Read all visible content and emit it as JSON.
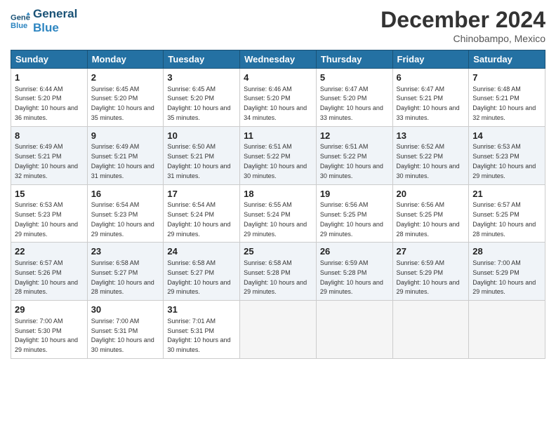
{
  "logo": {
    "line1": "General",
    "line2": "Blue"
  },
  "title": "December 2024",
  "subtitle": "Chinobampo, Mexico",
  "weekdays": [
    "Sunday",
    "Monday",
    "Tuesday",
    "Wednesday",
    "Thursday",
    "Friday",
    "Saturday"
  ],
  "weeks": [
    [
      {
        "day": "1",
        "sunrise": "6:44 AM",
        "sunset": "5:20 PM",
        "daylight": "10 hours and 36 minutes."
      },
      {
        "day": "2",
        "sunrise": "6:45 AM",
        "sunset": "5:20 PM",
        "daylight": "10 hours and 35 minutes."
      },
      {
        "day": "3",
        "sunrise": "6:45 AM",
        "sunset": "5:20 PM",
        "daylight": "10 hours and 35 minutes."
      },
      {
        "day": "4",
        "sunrise": "6:46 AM",
        "sunset": "5:20 PM",
        "daylight": "10 hours and 34 minutes."
      },
      {
        "day": "5",
        "sunrise": "6:47 AM",
        "sunset": "5:20 PM",
        "daylight": "10 hours and 33 minutes."
      },
      {
        "day": "6",
        "sunrise": "6:47 AM",
        "sunset": "5:21 PM",
        "daylight": "10 hours and 33 minutes."
      },
      {
        "day": "7",
        "sunrise": "6:48 AM",
        "sunset": "5:21 PM",
        "daylight": "10 hours and 32 minutes."
      }
    ],
    [
      {
        "day": "8",
        "sunrise": "6:49 AM",
        "sunset": "5:21 PM",
        "daylight": "10 hours and 32 minutes."
      },
      {
        "day": "9",
        "sunrise": "6:49 AM",
        "sunset": "5:21 PM",
        "daylight": "10 hours and 31 minutes."
      },
      {
        "day": "10",
        "sunrise": "6:50 AM",
        "sunset": "5:21 PM",
        "daylight": "10 hours and 31 minutes."
      },
      {
        "day": "11",
        "sunrise": "6:51 AM",
        "sunset": "5:22 PM",
        "daylight": "10 hours and 30 minutes."
      },
      {
        "day": "12",
        "sunrise": "6:51 AM",
        "sunset": "5:22 PM",
        "daylight": "10 hours and 30 minutes."
      },
      {
        "day": "13",
        "sunrise": "6:52 AM",
        "sunset": "5:22 PM",
        "daylight": "10 hours and 30 minutes."
      },
      {
        "day": "14",
        "sunrise": "6:53 AM",
        "sunset": "5:23 PM",
        "daylight": "10 hours and 29 minutes."
      }
    ],
    [
      {
        "day": "15",
        "sunrise": "6:53 AM",
        "sunset": "5:23 PM",
        "daylight": "10 hours and 29 minutes."
      },
      {
        "day": "16",
        "sunrise": "6:54 AM",
        "sunset": "5:23 PM",
        "daylight": "10 hours and 29 minutes."
      },
      {
        "day": "17",
        "sunrise": "6:54 AM",
        "sunset": "5:24 PM",
        "daylight": "10 hours and 29 minutes."
      },
      {
        "day": "18",
        "sunrise": "6:55 AM",
        "sunset": "5:24 PM",
        "daylight": "10 hours and 29 minutes."
      },
      {
        "day": "19",
        "sunrise": "6:56 AM",
        "sunset": "5:25 PM",
        "daylight": "10 hours and 29 minutes."
      },
      {
        "day": "20",
        "sunrise": "6:56 AM",
        "sunset": "5:25 PM",
        "daylight": "10 hours and 28 minutes."
      },
      {
        "day": "21",
        "sunrise": "6:57 AM",
        "sunset": "5:25 PM",
        "daylight": "10 hours and 28 minutes."
      }
    ],
    [
      {
        "day": "22",
        "sunrise": "6:57 AM",
        "sunset": "5:26 PM",
        "daylight": "10 hours and 28 minutes."
      },
      {
        "day": "23",
        "sunrise": "6:58 AM",
        "sunset": "5:27 PM",
        "daylight": "10 hours and 28 minutes."
      },
      {
        "day": "24",
        "sunrise": "6:58 AM",
        "sunset": "5:27 PM",
        "daylight": "10 hours and 29 minutes."
      },
      {
        "day": "25",
        "sunrise": "6:58 AM",
        "sunset": "5:28 PM",
        "daylight": "10 hours and 29 minutes."
      },
      {
        "day": "26",
        "sunrise": "6:59 AM",
        "sunset": "5:28 PM",
        "daylight": "10 hours and 29 minutes."
      },
      {
        "day": "27",
        "sunrise": "6:59 AM",
        "sunset": "5:29 PM",
        "daylight": "10 hours and 29 minutes."
      },
      {
        "day": "28",
        "sunrise": "7:00 AM",
        "sunset": "5:29 PM",
        "daylight": "10 hours and 29 minutes."
      }
    ],
    [
      {
        "day": "29",
        "sunrise": "7:00 AM",
        "sunset": "5:30 PM",
        "daylight": "10 hours and 29 minutes."
      },
      {
        "day": "30",
        "sunrise": "7:00 AM",
        "sunset": "5:31 PM",
        "daylight": "10 hours and 30 minutes."
      },
      {
        "day": "31",
        "sunrise": "7:01 AM",
        "sunset": "5:31 PM",
        "daylight": "10 hours and 30 minutes."
      },
      null,
      null,
      null,
      null
    ]
  ]
}
